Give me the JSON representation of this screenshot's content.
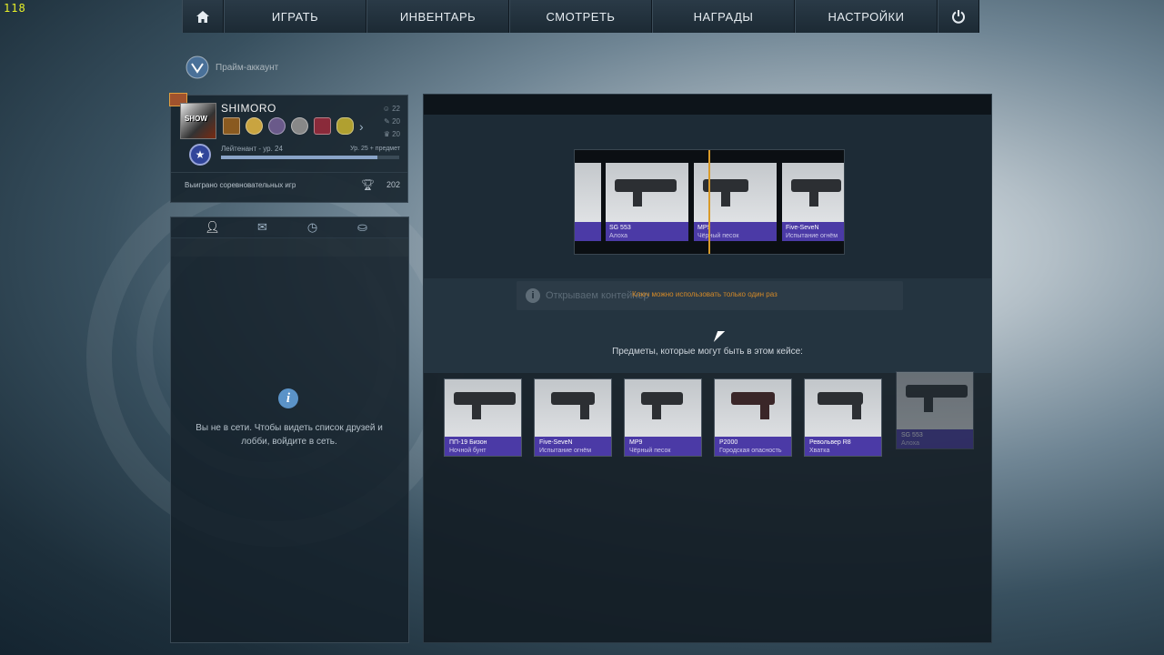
{
  "fps": "118",
  "nav": {
    "items": [
      "ИГРАТЬ",
      "ИНВЕНТАРЬ",
      "СМОТРЕТЬ",
      "НАГРАДЫ",
      "НАСТРОЙКИ"
    ]
  },
  "badge": {
    "text": "Прайм-аккаунт"
  },
  "profile": {
    "name": "SHIMORO",
    "avatar_text": "SHOW",
    "stats": [
      "22",
      "20",
      "20"
    ],
    "rank": "Лейтенант - ур. 24",
    "next_rank": "Ур. 25 + предмет",
    "xp_progress": 0.88,
    "wins_label": "Выиграно соревновательных игр",
    "wins_value": "202"
  },
  "friends": {
    "message": "Вы не в сети. Чтобы видеть список друзей и лобби, войдите в сеть."
  },
  "case": {
    "reel": [
      {
        "name": "SG 553",
        "skin": "Алоха"
      },
      {
        "name": "MP9",
        "skin": "Чёрный песок"
      },
      {
        "name": "Five-SeveN",
        "skin": "Испытание огнём"
      }
    ],
    "opening_text": "Открываем контейнер",
    "warning": "Ключ можно использовать только один раз",
    "contents_label": "Предметы, которые могут быть в этом кейсе:",
    "items": [
      {
        "name": "ПП-19 Бизон",
        "skin": "Ночной бунт"
      },
      {
        "name": "Five-SeveN",
        "skin": "Испытание огнём"
      },
      {
        "name": "MP9",
        "skin": "Чёрный песок"
      },
      {
        "name": "P2000",
        "skin": "Городская опасность"
      },
      {
        "name": "Револьвер R8",
        "skin": "Хватка"
      },
      {
        "name": "SG 553",
        "skin": "Алоха"
      }
    ]
  }
}
